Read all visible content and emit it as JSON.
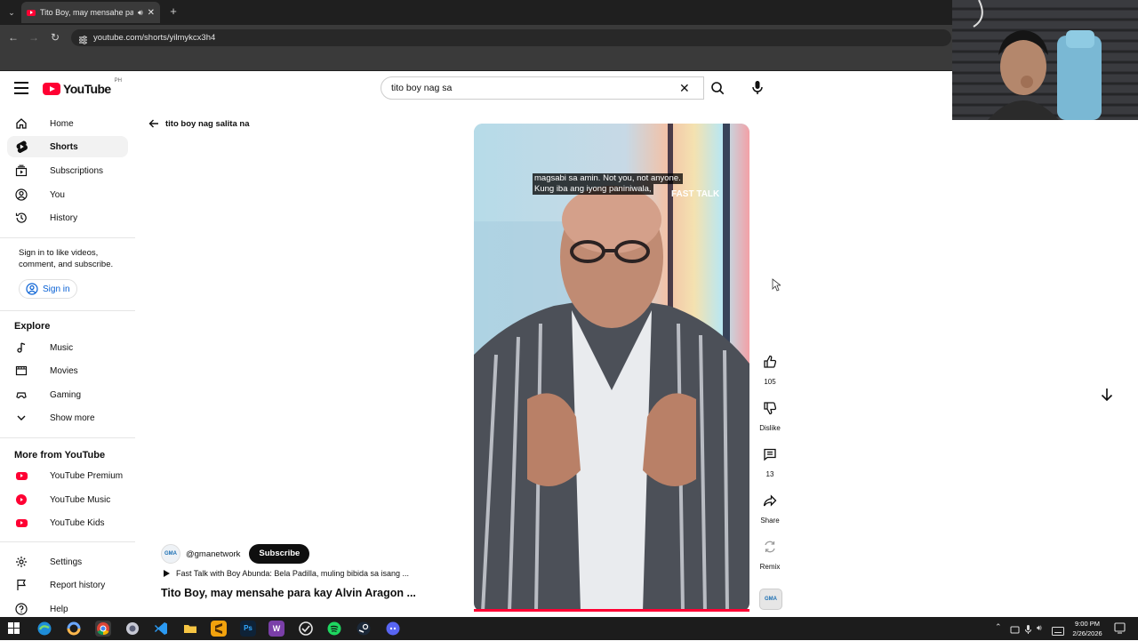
{
  "browser": {
    "tab_title": "Tito Boy, may mensahe para kay Alvin Aragon",
    "url": "youtube.com/shorts/yilmykcx3h4"
  },
  "header": {
    "logo_text": "YouTube",
    "country_code": "PH",
    "search_value": "tito boy nag sa"
  },
  "sidebar": {
    "main": [
      {
        "label": "Home",
        "icon": "home-icon"
      },
      {
        "label": "Shorts",
        "icon": "shorts-icon"
      },
      {
        "label": "Subscriptions",
        "icon": "subscriptions-icon"
      },
      {
        "label": "You",
        "icon": "you-icon"
      },
      {
        "label": "History",
        "icon": "history-icon"
      }
    ],
    "signin_text": "Sign in to like videos, comment, and subscribe.",
    "signin_button": "Sign in",
    "explore_title": "Explore",
    "explore": [
      {
        "label": "Music",
        "icon": "music-icon"
      },
      {
        "label": "Movies",
        "icon": "movies-icon"
      },
      {
        "label": "Gaming",
        "icon": "gaming-icon"
      },
      {
        "label": "Show more",
        "icon": "chevron-down-icon"
      }
    ],
    "more_title": "More from YouTube",
    "more": [
      {
        "label": "YouTube Premium",
        "icon": "youtube-premium-icon"
      },
      {
        "label": "YouTube Music",
        "icon": "youtube-music-icon"
      },
      {
        "label": "YouTube Kids",
        "icon": "youtube-kids-icon"
      }
    ],
    "bottom": [
      {
        "label": "Settings",
        "icon": "settings-icon"
      },
      {
        "label": "Report history",
        "icon": "flag-icon"
      },
      {
        "label": "Help",
        "icon": "help-icon"
      }
    ]
  },
  "shorts": {
    "back_label": "tito boy nag salita na",
    "caption_line1": "magsabi sa amin. Not you, not anyone.",
    "caption_line2": "Kung iba ang iyong paniniwala,",
    "video_watermark": "FAST TALK",
    "channel": "@gmanetwork",
    "channel_avatar_text": "GMA",
    "subscribe_label": "Subscribe",
    "playlist_text": "Fast Talk with Boy Abunda: Bela Padilla, muling bibida sa isang ...",
    "title": "Tito Boy, may mensahe para kay Alvin Aragon ...",
    "actions": {
      "like_count": "105",
      "dislike_label": "Dislike",
      "comments_count": "13",
      "share_label": "Share",
      "remix_label": "Remix"
    }
  },
  "taskbar": {
    "time": "9:00 PM",
    "date": "2/26/2026"
  },
  "colors": {
    "brand_red": "#ff0033",
    "link_blue": "#065fd4",
    "text": "#0f0f0f"
  }
}
